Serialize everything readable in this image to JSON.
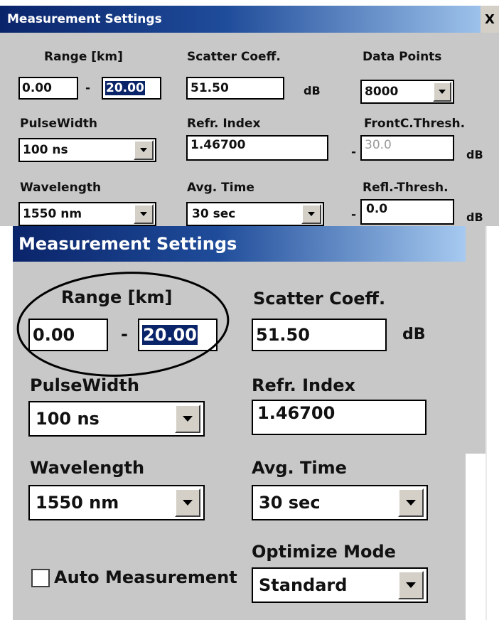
{
  "back_dialog": {
    "title": "Measurement Settings",
    "close_glyph": "X",
    "range_label": "Range [km]",
    "range_from": "0.00",
    "range_separator": "-",
    "range_to": "20.00",
    "scatter_label": "Scatter Coeff.",
    "scatter_value": "51.50",
    "scatter_unit": "dB",
    "datapoints_label": "Data Points",
    "datapoints_value": "8000",
    "pulsewidth_label": "PulseWidth",
    "pulsewidth_value": "100 ns",
    "refr_label": "Refr. Index",
    "refr_value": "1.46700",
    "frontc_label": "FrontC.Thresh.",
    "frontc_separator": "-",
    "frontc_value": "30.0",
    "frontc_unit": "dB",
    "wavelength_label": "Wavelength",
    "wavelength_value": "1550 nm",
    "avgtime_label": "Avg. Time",
    "avgtime_value": "30 sec",
    "refl_label": "Refl.-Thresh.",
    "refl_separator": "-",
    "refl_value": "0.0",
    "refl_unit": "dB"
  },
  "front_dialog": {
    "title": "Measurement Settings",
    "range_label": "Range [km]",
    "range_from": "0.00",
    "range_separator": "-",
    "range_to": "20.00",
    "scatter_label": "Scatter Coeff.",
    "scatter_value": "51.50",
    "scatter_unit": "dB",
    "pulsewidth_label": "PulseWidth",
    "pulsewidth_value": "100 ns",
    "refr_label": "Refr. Index",
    "refr_value": "1.46700",
    "wavelength_label": "Wavelength",
    "wavelength_value": "1550 nm",
    "avgtime_label": "Avg. Time",
    "avgtime_value": "30 sec",
    "optimize_label": "Optimize Mode",
    "optimize_value": "Standard",
    "auto_measurement_label": "Auto Measurement",
    "auto_measurement_checked": false
  },
  "annotation": {
    "highlight": "range-circle"
  }
}
